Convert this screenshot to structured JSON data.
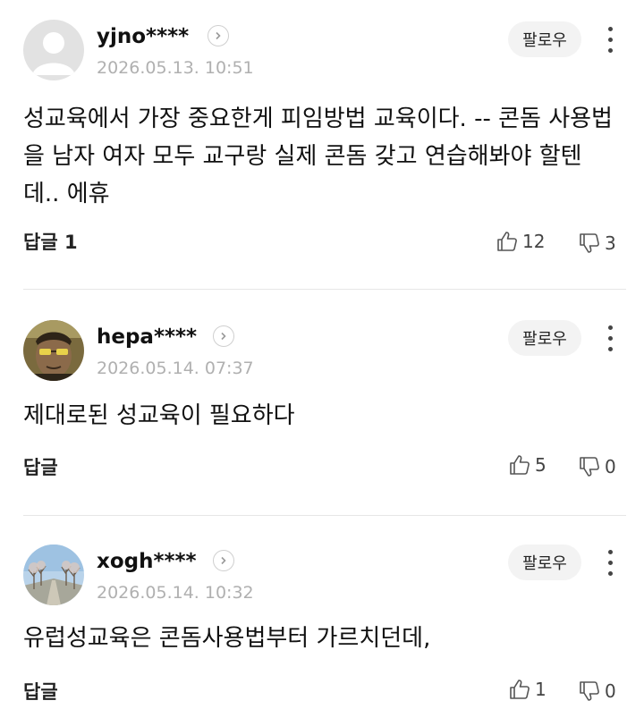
{
  "comments": [
    {
      "username": "yjno****",
      "timestamp": "2026.05.13. 10:51",
      "follow_label": "팔로우",
      "text": "성교육에서 가장 중요한게 피임방법 교육이다. -- 콘돔 사용법을 남자 여자 모두 교구랑 실제 콘돔 갖고 연습해봐야 할텐데.. 에휴",
      "reply_label": "답글 1",
      "likes": "12",
      "dislikes": "3",
      "avatar": "default-avatar"
    },
    {
      "username": "hepa****",
      "timestamp": "2026.05.14. 07:37",
      "follow_label": "팔로우",
      "text": "제대로된 성교육이 필요하다",
      "reply_label": "답글",
      "likes": "5",
      "dislikes": "0",
      "avatar": "photo-avatar-face"
    },
    {
      "username": "xogh****",
      "timestamp": "2026.05.14. 10:32",
      "follow_label": "팔로우",
      "text": "유럽성교육은 콘돔사용법부터 가르치던데,",
      "reply_label": "답글",
      "likes": "1",
      "dislikes": "0",
      "avatar": "photo-avatar-trees"
    }
  ],
  "colors": {
    "text": "#111111",
    "timestamp": "#b0b0b0",
    "follow_bg": "#f3f3f3",
    "divider": "#e6e6e6"
  }
}
